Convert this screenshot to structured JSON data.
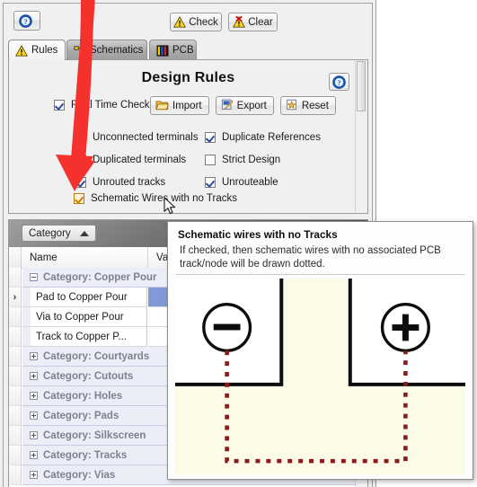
{
  "app": {
    "toolbar": {
      "help_label": "",
      "help_icon": "help-circle-icon",
      "check_label": "Check",
      "check_icon": "warning-triangle-icon",
      "clear_label": "Clear",
      "clear_icon": "warning-triangle-delete-icon"
    },
    "tabs": [
      {
        "label": "Rules",
        "icon": "warning-triangle-icon",
        "active": true
      },
      {
        "label": "Schematics",
        "icon": "schematic-symbol-icon",
        "active": false
      },
      {
        "label": "PCB",
        "icon": "pcb-board-icon",
        "active": false
      }
    ]
  },
  "rules_panel": {
    "title": "Design Rules",
    "help_icon": "help-circle-icon",
    "realtime": {
      "label": "Real Time Check",
      "checked": true
    },
    "buttons": [
      {
        "label": "Import",
        "icon": "folder-open-icon"
      },
      {
        "label": "Export",
        "icon": "export-document-icon"
      },
      {
        "label": "Reset",
        "icon": "reset-star-icon"
      }
    ],
    "checks": [
      {
        "label": "Unconnected terminals",
        "checked": true
      },
      {
        "label": "Duplicate References",
        "checked": true
      },
      {
        "label": "Duplicated terminals",
        "checked": true
      },
      {
        "label": "Strict Design",
        "checked": false
      },
      {
        "label": "Unrouted tracks",
        "checked": true
      },
      {
        "label": "Unrouteable",
        "checked": true
      }
    ],
    "highlighted_check": {
      "label": "Schematic Wires with no Tracks",
      "checked": true
    }
  },
  "grid": {
    "groupbar": {
      "chip_label": "Category",
      "sort_direction": "ascending"
    },
    "columns": [
      "Name",
      "Value"
    ],
    "rows": [
      {
        "type": "group",
        "label": "Category: Copper Pour",
        "expanded": true
      },
      {
        "type": "data",
        "name": "Pad to Copper Pour",
        "value": "",
        "selected": true,
        "indicator": "›"
      },
      {
        "type": "data",
        "name": "Via to Copper Pour",
        "value": "",
        "selected": false,
        "indicator": ""
      },
      {
        "type": "data",
        "name": "Track to Copper P...",
        "value": "",
        "selected": false,
        "indicator": ""
      },
      {
        "type": "group",
        "label": "Category: Courtyards",
        "expanded": false
      },
      {
        "type": "group",
        "label": "Category: Cutouts",
        "expanded": false
      },
      {
        "type": "group",
        "label": "Category: Holes",
        "expanded": false
      },
      {
        "type": "group",
        "label": "Category: Pads",
        "expanded": false
      },
      {
        "type": "group",
        "label": "Category: Silkscreen",
        "expanded": false
      },
      {
        "type": "group",
        "label": "Category: Tracks",
        "expanded": false
      },
      {
        "type": "group",
        "label": "Category: Vias",
        "expanded": false
      }
    ]
  },
  "tooltip": {
    "title": "Schematic wires with no Tracks",
    "body": "If checked, then schematic wires with no associated PCB track/node will be drawn dotted.",
    "figure": {
      "left_symbol": "minus-in-circle",
      "right_symbol": "plus-in-circle",
      "dotted_wire_color": "#8b1a1a",
      "background_color": "#fbfbe8"
    }
  },
  "annotation": {
    "arrow_color": "#f4312d",
    "arrow_target": "Schematic Wires with no Tracks checkbox"
  },
  "cursor": {
    "icon": "mouse-pointer-icon"
  }
}
